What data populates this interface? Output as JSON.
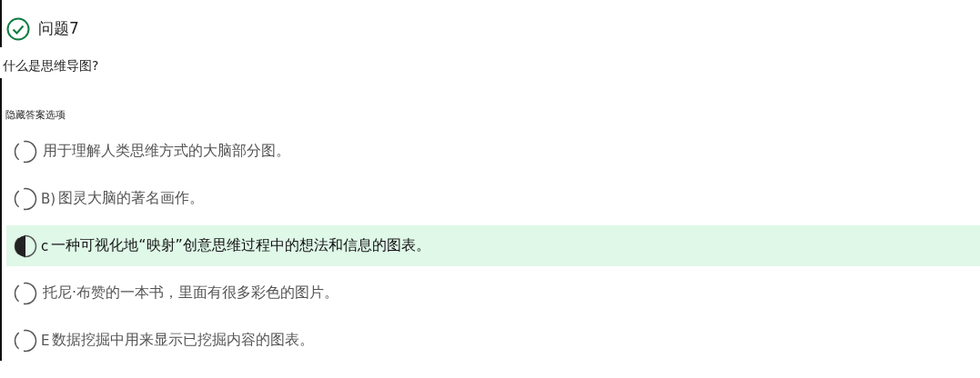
{
  "question": {
    "title": "问题7",
    "correct": true,
    "prompt": "什么是思维导图?",
    "toggle": "隐藏答案选项"
  },
  "options": [
    {
      "text": "用于理解人类思维方式的大脑部分图。",
      "selected": false
    },
    {
      "letter": "B)",
      "text": "图灵大脑的著名画作。",
      "selected": false
    },
    {
      "letter": "c",
      "text": "一种可视化地“映射”创意思维过程中的想法和信息的图表。",
      "selected": true
    },
    {
      "text": "托尼·布赞的一本书，里面有很多彩色的图片。",
      "selected": false
    },
    {
      "letter": "E",
      "text": "数据挖掘中用来显示已挖掘内容的图表。",
      "selected": false
    }
  ]
}
